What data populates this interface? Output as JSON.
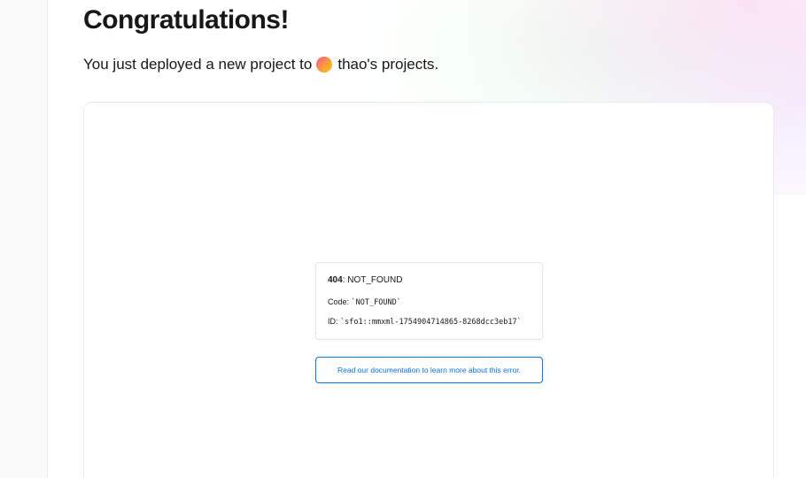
{
  "header": {
    "title": "Congratulations!",
    "subtitle_prefix": "You just deployed a new project to",
    "team_name": "thao's projects",
    "subtitle_suffix": "."
  },
  "preview": {
    "error": {
      "status_code": "404",
      "status_text": ": NOT_FOUND",
      "code_label": "Code: ",
      "code_value": "`NOT_FOUND`",
      "id_label": "ID: ",
      "id_value": "`sfo1::mmxml-1754904714865-8268dcc3eb17`"
    },
    "doc_link_label": "Read our documentation to learn more about this error."
  },
  "colors": {
    "accent_link": "#0a72ef",
    "border": "#ebebeb",
    "text": "#171717"
  }
}
